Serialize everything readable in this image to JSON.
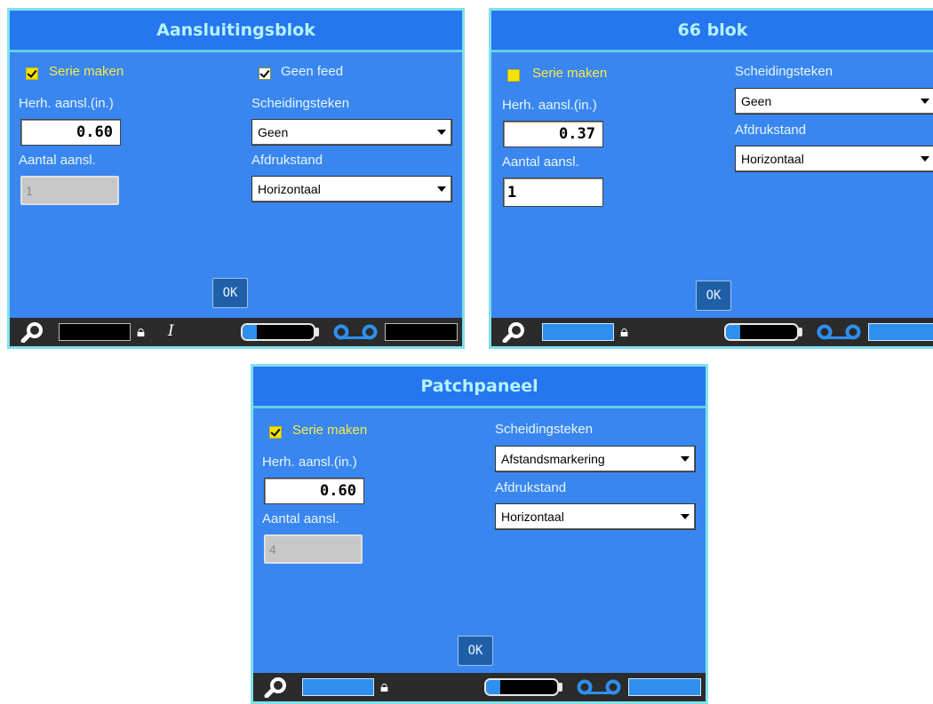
{
  "screens": [
    {
      "title": "Aansluitingsblok",
      "serie_label": "Serie maken",
      "geen_feed_label": "Geen feed",
      "herh_label": "Herh. aansl.(in.)",
      "herh_value": "0.60",
      "aantal_label": "Aantal aansl.",
      "aantal_value": "1",
      "scheidingsteken_label": "Scheidingsteken",
      "scheidingsteken_value": "Geen",
      "afdrukstand_label": "Afdrukstand",
      "afdrukstand_value": "Horizontaal",
      "ok_label": "OK",
      "serie_checked": true,
      "geen_feed_checked": true,
      "aantal_enabled": false,
      "battery_level": 0.2,
      "status_icons": [
        "zoom-icon",
        "lock-icon",
        "text-cursor-icon",
        "battery-icon",
        "ribbon-icon"
      ]
    },
    {
      "title": "66 blok",
      "serie_label": "Serie maken",
      "herh_label": "Herh. aansl.(in.)",
      "herh_value": "0.37",
      "aantal_label": "Aantal aansl.",
      "aantal_value": "1",
      "scheidingsteken_label": "Scheidingsteken",
      "scheidingsteken_value": "Geen",
      "afdrukstand_label": "Afdrukstand",
      "afdrukstand_value": "Horizontaal",
      "ok_label": "OK",
      "serie_checked": false,
      "aantal_enabled": true,
      "battery_level": 0.2,
      "status_icons": [
        "zoom-icon",
        "lock-icon",
        "battery-icon",
        "ribbon-icon"
      ]
    },
    {
      "title": "Patchpaneel",
      "serie_label": "Serie maken",
      "herh_label": "Herh. aansl.(in.)",
      "herh_value": "0.60",
      "aantal_label": "Aantal aansl.",
      "aantal_value": "4",
      "scheidingsteken_label": "Scheidingsteken",
      "scheidingsteken_value": "Afstandsmarkering",
      "afdrukstand_label": "Afdrukstand",
      "afdrukstand_value": "Horizontaal",
      "ok_label": "OK",
      "serie_checked": true,
      "aantal_enabled": false,
      "battery_level": 0.2,
      "status_icons": [
        "zoom-icon",
        "lock-icon",
        "battery-icon",
        "ribbon-icon"
      ]
    }
  ],
  "colors": {
    "screen_bg": "#3a86f0",
    "title_bg": "#2676f0",
    "title_text": "#b5f3ff",
    "border": "#7fe0ea",
    "serie_label": "#f7e94a",
    "statusbar_bg": "#2b2b2b"
  }
}
